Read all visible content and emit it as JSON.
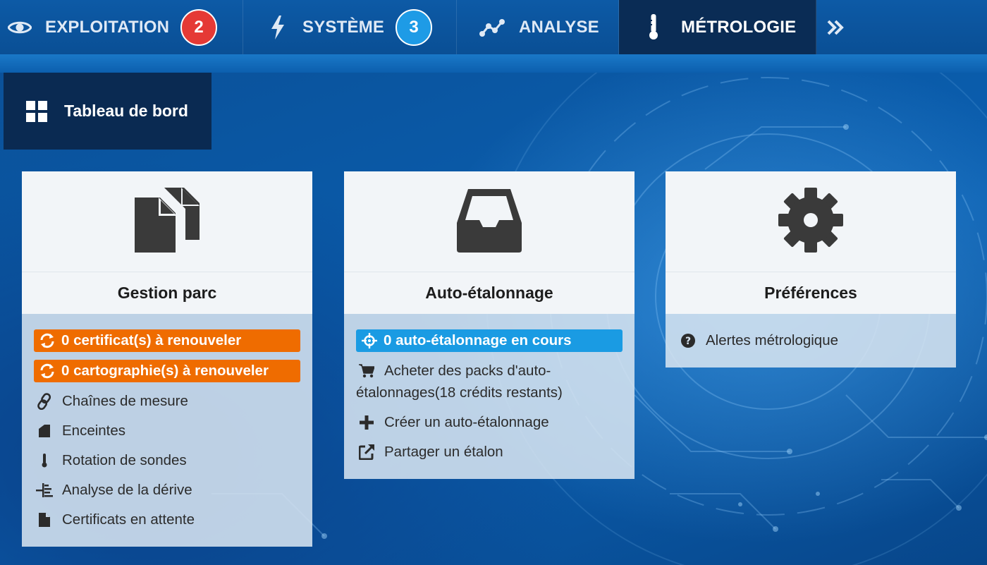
{
  "nav": {
    "tabs": [
      {
        "label": "EXPLOITATION",
        "badge": "2",
        "icon": "eye-icon"
      },
      {
        "label": "SYSTÈME",
        "badge": "3",
        "icon": "bolt-icon"
      },
      {
        "label": "ANALYSE",
        "icon": "line-chart-icon"
      },
      {
        "label": "MÉTROLOGIE",
        "icon": "thermometer-icon",
        "active": true
      },
      {
        "icon": "double-chevron-right-icon"
      }
    ],
    "colors": {
      "badge_red": "#e53935",
      "badge_blue": "#1e9be6",
      "active_tab": "#0a2c55"
    }
  },
  "subnav": {
    "label": "Tableau de bord",
    "icon": "dashboard-grid-icon"
  },
  "cards": [
    {
      "title": "Gestion parc",
      "icon": "copy-files-icon",
      "alerts": [
        {
          "label": "0 certificat(s) à renouveler",
          "icon": "refresh-icon",
          "color": "#ef6c00"
        },
        {
          "label": "0 cartographie(s) à renouveler",
          "icon": "refresh-icon",
          "color": "#ef6c00"
        }
      ],
      "links": [
        {
          "label": "Chaînes de mesure",
          "icon": "link-icon"
        },
        {
          "label": "Enceintes",
          "icon": "enclosure-icon"
        },
        {
          "label": "Rotation de sondes",
          "icon": "probe-icon"
        },
        {
          "label": "Analyse de la dérive",
          "icon": "drift-icon"
        },
        {
          "label": "Certificats en attente",
          "icon": "file-icon"
        }
      ]
    },
    {
      "title": "Auto-étalonnage",
      "icon": "inbox-tray-icon",
      "alerts": [
        {
          "label": "0 auto-étalonnage en cours",
          "icon": "crosshair-icon",
          "color": "#1a9be3"
        }
      ],
      "links": [
        {
          "label": "Acheter des packs d'auto-étalonnages(18 crédits restants)",
          "label_line1": "Acheter des packs d'auto-",
          "label_line2": "étalonnages(18 crédits restants)",
          "icon": "cart-icon"
        },
        {
          "label": "Créer un auto-étalonnage",
          "icon": "plus-icon"
        },
        {
          "label": "Partager un étalon",
          "icon": "share-external-icon"
        }
      ]
    },
    {
      "title": "Préférences",
      "icon": "gear-icon",
      "links": [
        {
          "label": "Alertes métrologique",
          "icon": "question-circle-icon"
        }
      ]
    }
  ]
}
